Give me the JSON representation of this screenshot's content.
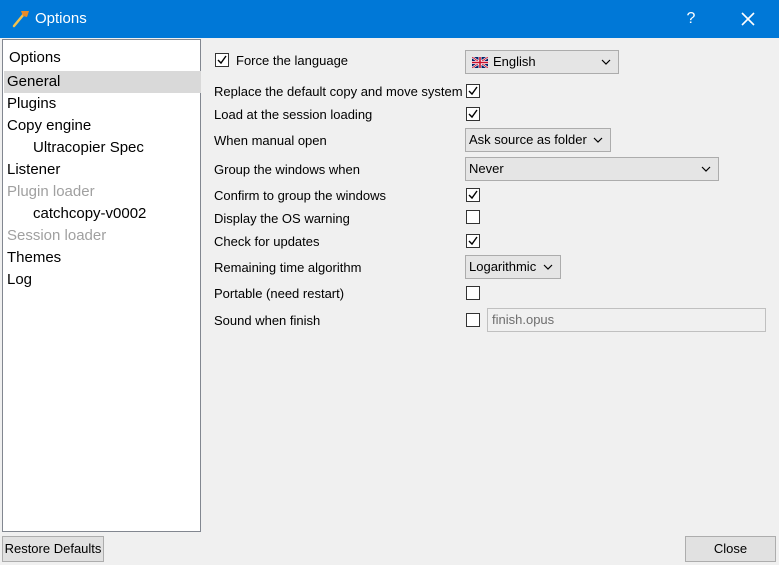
{
  "window": {
    "title": "Options",
    "help_label": "?"
  },
  "sidebar": {
    "header": "Options",
    "items": [
      {
        "label": "General"
      },
      {
        "label": "Plugins"
      },
      {
        "label": "Copy engine"
      },
      {
        "label": "Ultracopier Spec"
      },
      {
        "label": "Listener"
      },
      {
        "label": "Plugin loader"
      },
      {
        "label": "catchcopy-v0002"
      },
      {
        "label": "Session loader"
      },
      {
        "label": "Themes"
      },
      {
        "label": "Log"
      }
    ]
  },
  "general": {
    "force_language": {
      "label": "Force the language",
      "checked": true
    },
    "language": {
      "value": "English"
    },
    "replace_copy": {
      "label": "Replace the default copy and move system",
      "checked": true
    },
    "load_session": {
      "label": "Load at the session loading",
      "checked": true
    },
    "manual_open": {
      "label": "When manual open",
      "value": "Ask source as folder"
    },
    "group_windows": {
      "label": "Group the windows when",
      "value": "Never"
    },
    "confirm_group": {
      "label": "Confirm to group the windows",
      "checked": true
    },
    "os_warning": {
      "label": "Display the OS warning",
      "checked": false
    },
    "check_updates": {
      "label": "Check for updates",
      "checked": true
    },
    "remaining_time": {
      "label": "Remaining time algorithm",
      "value": "Logarithmic"
    },
    "portable": {
      "label": "Portable (need restart)",
      "checked": false
    },
    "sound_finish": {
      "label": "Sound when finish",
      "checked": false,
      "file": "finish.opus"
    }
  },
  "buttons": {
    "restore_defaults": "Restore Defaults",
    "close": "Close"
  },
  "colors": {
    "titlebar": "#0078d7",
    "selection": "#d9d9d9",
    "disabled_text": "#a0a0a0"
  }
}
